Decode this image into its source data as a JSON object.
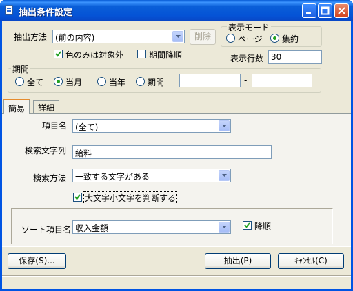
{
  "window": {
    "title": "抽出条件設定"
  },
  "extract_method": {
    "label": "抽出方法",
    "value": "(前の内容)",
    "delete_label": "削除"
  },
  "display_mode": {
    "label": "表示モード",
    "options": [
      "ページ",
      "集約"
    ],
    "selected": "集約"
  },
  "color_only": {
    "label": "色のみは対象外",
    "checked": true
  },
  "period_desc": {
    "label": "期間降順",
    "checked": false
  },
  "display_rows": {
    "label": "表示行数",
    "value": "30"
  },
  "period": {
    "label": "期間",
    "options": [
      "全て",
      "当月",
      "当年",
      "期間"
    ],
    "selected": "当月",
    "from": "",
    "separator": "-",
    "to": ""
  },
  "tabs": [
    "簡易",
    "詳細"
  ],
  "simple": {
    "item_name": {
      "label": "項目名",
      "value": "(全て)"
    },
    "search_text": {
      "label": "検索文字列",
      "value": "給料"
    },
    "search_method": {
      "label": "検索方法",
      "value": "一致する文字がある"
    },
    "case_sensitive": {
      "label": "大文字小文字を判断する",
      "checked": true
    },
    "sort_item": {
      "label": "ソート項目名",
      "value": "収入金額"
    },
    "descending": {
      "label": "降順",
      "checked": true
    }
  },
  "buttons": {
    "save": "保存(S)...",
    "extract": "抽出(P)",
    "cancel": "ｷｬﾝｾﾙ(C)"
  },
  "colors": {
    "titlebar": "#0054e3",
    "face": "#ece9d8",
    "radio_dot": "#21a121"
  }
}
